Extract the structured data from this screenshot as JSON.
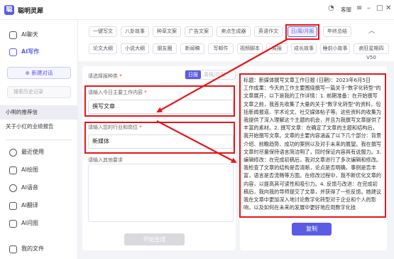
{
  "app": {
    "title": "聪明灵犀",
    "logo_char": "聪",
    "titlebar_text": "客服"
  },
  "sidebar": {
    "top_items": [
      {
        "label": "AI聊天"
      },
      {
        "label": "AI写作"
      }
    ],
    "new_chat_label": "⊕ 新建对话",
    "search_placeholder": "搜索历史记录",
    "history": [
      {
        "label": "小明的推荐信"
      },
      {
        "label": "关于小红的业绩报告"
      }
    ],
    "bottom_items": [
      {
        "label": "最近使用"
      },
      {
        "label": "AI绘图"
      },
      {
        "label": "AI语音"
      },
      {
        "label": "AI翻译"
      },
      {
        "label": "AI问图"
      },
      {
        "label": "我的文件"
      }
    ]
  },
  "templates": {
    "row1": [
      "一键写文",
      "八卦故事",
      "种草文案",
      "广告文案",
      "卖点生成器",
      "英语作文",
      "日/周/月报",
      "年终总结"
    ],
    "row2": [
      "论文大纲",
      "小说大纲",
      "朋友圈",
      "新闻稿",
      "写邮件",
      "视频脚本",
      "周报",
      "成长故事",
      "睡前小故事",
      "疯狂星期四V50"
    ],
    "active": "日/周/月报"
  },
  "form": {
    "type_label": "请选择报种类",
    "type_options": [
      "日报",
      "周报/月报"
    ],
    "theme_label": "请输入今日主要工作内容",
    "theme_value": "撰写文章",
    "industry_label": "请输入您的行业和岗位",
    "industry_value": "新媒体",
    "other_label": "请输入其他要求",
    "other_placeholder": "",
    "generate_label": "开始生成"
  },
  "output": {
    "text": "标题：新媒体撰写文章工作日报 (日期)：2023年6月5日\n工作成果：今天的工作主要围绕撰写一篇关于\"数字化转型\"的文章展开，以下是我的工作详情：1. 前期准备：在开始撰写文章之前，我首先收集了大量的关于\"数字化转型\"的资料，包括新闻报道、学术论文、社交媒体帖子等。这些资料的收集为我提供了深入理解这个主题的机会，并且为我撰写文章提供了丰富的素材。2. 撰写文章：在确定了文章的主题和结构后，我开始撰写文章。文章的主要内容涵盖了以下几个部分：背景介绍、前瞻趋势、成功的案例以及对于未来的展望。我在撰写文章时尽量保持语言简洁明了，同时保证内容具有说服力。3. 编辑修改：在完成初稿后，我对文章进行了多次编辑和修改。我检查了文章的结构是否清晰，论点是否明确，事例是否丰富，语言是否流畅等方面。在修改过程中，我不断优化文章的内容，以提高其可读性和吸引力。4. 反馈与改进：在完成初稿后，我向我的导师提交了文章，并获得了一些反馈。她建议我在文章中更加深入地讨论数字化转型对于企业和个人的影响，以及如何在未来的发展中更好地应用数字化技",
    "copy_label": "复制"
  }
}
